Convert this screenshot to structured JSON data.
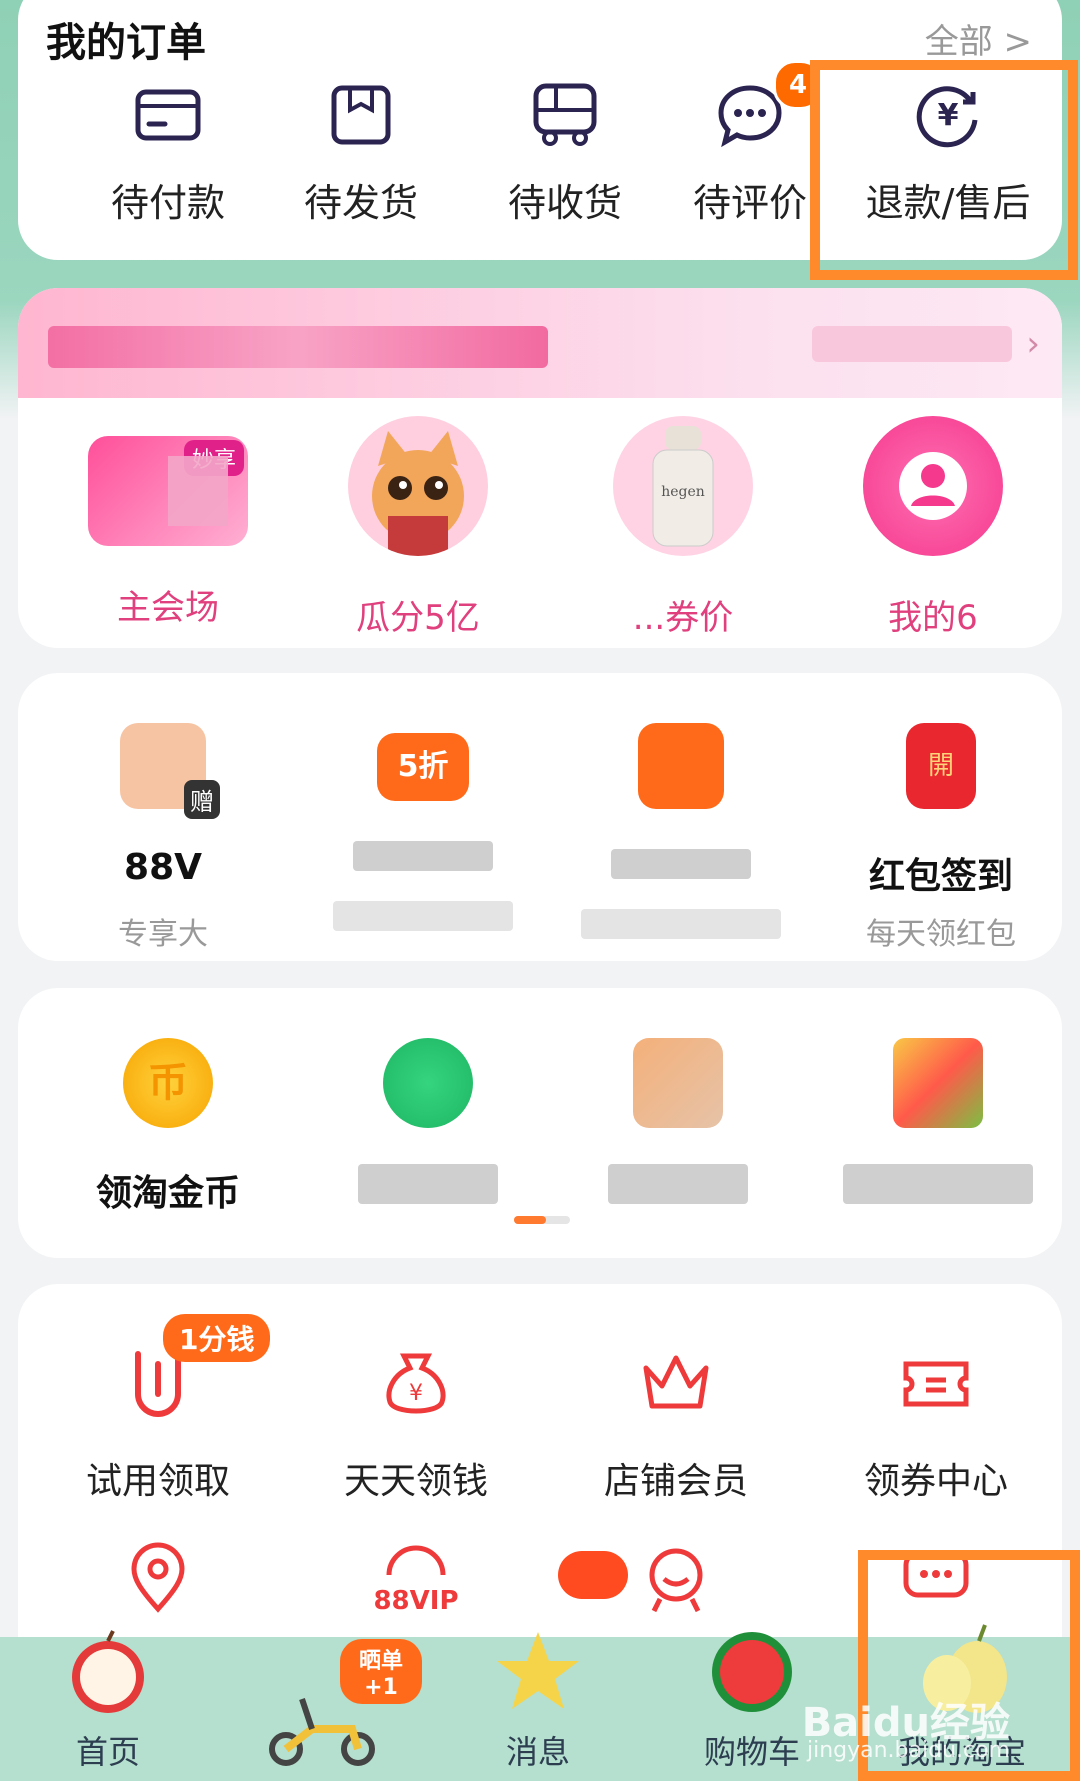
{
  "orders": {
    "title": "我的订单",
    "all_link": "全部 >",
    "items": [
      {
        "label": "待付款",
        "icon": "card-icon"
      },
      {
        "label": "待发货",
        "icon": "box-icon"
      },
      {
        "label": "待收货",
        "icon": "truck-icon"
      },
      {
        "label": "待评价",
        "icon": "comment-icon",
        "badge": "4"
      },
      {
        "label": "退款/售后",
        "icon": "refund-yen-icon"
      }
    ]
  },
  "promo": {
    "more": "›",
    "badge": "妙享",
    "items": [
      {
        "label": "主会场"
      },
      {
        "label": "瓜分5亿"
      },
      {
        "label": "...券价"
      },
      {
        "label": "我的6"
      }
    ],
    "bottle_text": "hegen"
  },
  "tools": [
    {
      "title": "88V",
      "sub": "专享大",
      "badge": "赠"
    },
    {
      "title": "",
      "sub": "",
      "badge": "5折"
    },
    {
      "title": "",
      "sub": "",
      "badge": ""
    },
    {
      "title": "红包签到",
      "sub": "每天领红包",
      "badge": "開"
    }
  ],
  "games": [
    {
      "title": "领淘金币",
      "icon_glyph": "币"
    },
    {
      "title": ""
    },
    {
      "title": ""
    },
    {
      "title": ""
    }
  ],
  "services": [
    {
      "label": "试用领取",
      "icon": "trial-icon",
      "tag": "1分钱"
    },
    {
      "label": "天天领钱",
      "icon": "money-bag-icon"
    },
    {
      "label": "店铺会员",
      "icon": "crown-icon"
    },
    {
      "label": "领券中心",
      "icon": "coupon-icon"
    },
    {
      "label": "",
      "icon": "location-icon"
    },
    {
      "label": "",
      "icon": "88vip-icon",
      "icon_text": "88VIP"
    },
    {
      "label": "",
      "icon": "mascot-icon"
    },
    {
      "label": "",
      "icon": "chat-icon"
    }
  ],
  "tabbar": {
    "items": [
      {
        "label": "首页",
        "icon": "apple-icon"
      },
      {
        "label": "",
        "icon": "scooter-icon",
        "tag": "晒单+1"
      },
      {
        "label": "消息",
        "icon": "starfruit-icon"
      },
      {
        "label": "购物车",
        "icon": "watermelon-icon"
      },
      {
        "label": "我的淘宝",
        "icon": "pear-icon"
      }
    ]
  },
  "watermark": {
    "logo": "Baidu经验",
    "url": "jingyan.baidu.com"
  },
  "colors": {
    "accent": "#ff6a00",
    "highlight": "#ff8a2b",
    "pink": "#e0407d",
    "tabbar": "#b5dfce"
  }
}
